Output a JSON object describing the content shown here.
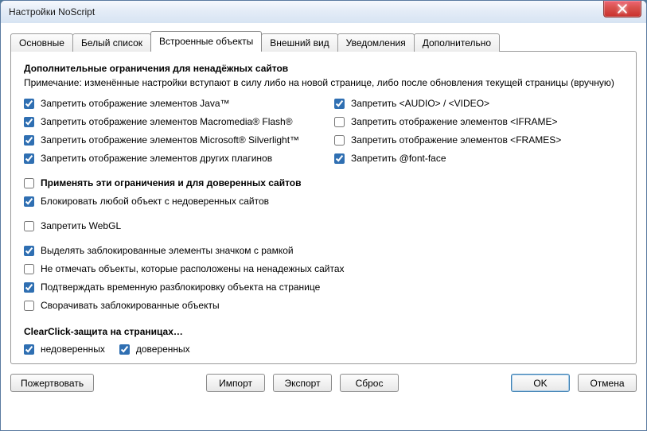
{
  "window": {
    "title": "Настройки NoScript"
  },
  "tabs": [
    {
      "label": "Основные"
    },
    {
      "label": "Белый список"
    },
    {
      "label": "Встроенные объекты",
      "active": true
    },
    {
      "label": "Внешний вид"
    },
    {
      "label": "Уведомления"
    },
    {
      "label": "Дополнительно"
    }
  ],
  "section": {
    "title": "Дополнительные ограничения для ненадёжных сайтов",
    "note": "Примечание: изменённые настройки вступают в силу либо на новой странице, либо после обновления текущей страницы (вручную)"
  },
  "left_col": [
    {
      "label": "Запретить отображение элементов Java™",
      "checked": true
    },
    {
      "label": "Запретить отображение элементов Macromedia® Flash®",
      "checked": true
    },
    {
      "label": "Запретить отображение элементов Microsoft® Silverlight™",
      "checked": true
    },
    {
      "label": "Запретить отображение элементов других плагинов",
      "checked": true
    }
  ],
  "right_col": [
    {
      "label": "Запретить <AUDIO> / <VIDEO>",
      "checked": true
    },
    {
      "label": "Запретить отображение элементов <IFRAME>",
      "checked": false
    },
    {
      "label": "Запретить отображение элементов <FRAMES>",
      "checked": false
    },
    {
      "label": "Запретить @font-face",
      "checked": true
    }
  ],
  "group2": [
    {
      "label": "Применять эти ограничения и для доверенных сайтов",
      "checked": false,
      "bold": true
    },
    {
      "label": "Блокировать любой объект с недоверенных сайтов",
      "checked": true
    }
  ],
  "group3": [
    {
      "label": "Запретить WebGL",
      "checked": false
    }
  ],
  "group4": [
    {
      "label": "Выделять заблокированные элементы значком с рамкой",
      "checked": true
    },
    {
      "label": "Не отмечать объекты, которые расположены на ненадежных сайтах",
      "checked": false
    },
    {
      "label": "Подтверждать временную разблокировку объекта на странице",
      "checked": true
    },
    {
      "label": "Сворачивать заблокированные объекты",
      "checked": false
    }
  ],
  "clearclick": {
    "title": "ClearClick-защита на страницах…",
    "items": [
      {
        "label": "недоверенных",
        "checked": true
      },
      {
        "label": "доверенных",
        "checked": true
      }
    ]
  },
  "footer": {
    "donate": "Пожертвовать",
    "import": "Импорт",
    "export": "Экспорт",
    "reset": "Сброс",
    "ok": "OK",
    "cancel": "Отмена"
  }
}
